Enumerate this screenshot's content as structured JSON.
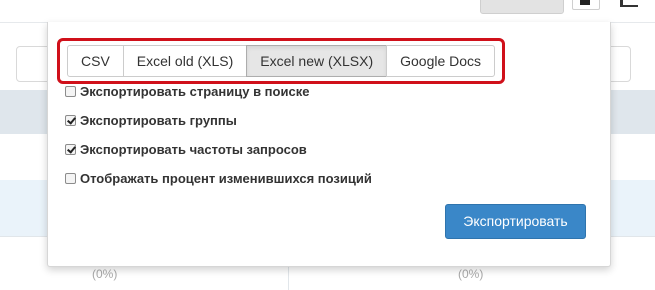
{
  "background": {
    "percent_left": "(0%)",
    "percent_right": "(0%)"
  },
  "export_popover": {
    "formats": [
      {
        "label": "CSV",
        "active": false
      },
      {
        "label": "Excel old (XLS)",
        "active": false
      },
      {
        "label": "Excel new (XLSX)",
        "active": true
      },
      {
        "label": "Google Docs",
        "active": false
      }
    ],
    "options": [
      {
        "label": "Экспортировать страницу в поиске",
        "checked": false
      },
      {
        "label": "Экспортировать группы",
        "checked": true
      },
      {
        "label": "Экспортировать частоты запросов",
        "checked": true
      },
      {
        "label": "Отображать процент изменившихся позиций",
        "checked": false
      }
    ],
    "export_button": "Экспортировать"
  },
  "colors": {
    "highlight_border": "#d0101a",
    "primary_button": "#3a87c8",
    "header_band": "#dfe6ec",
    "row_band": "#eaf3fa"
  },
  "icons": {
    "toolbar_icon_1": "table-icon",
    "toolbar_icon_2": "chart-icon"
  }
}
